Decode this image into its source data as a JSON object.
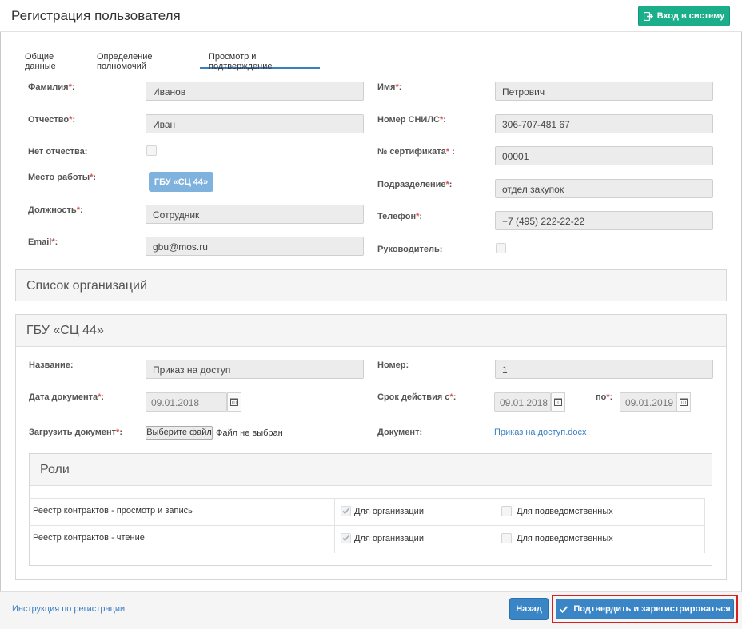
{
  "header": {
    "title": "Регистрация пользователя",
    "login_label": "Вход в систему"
  },
  "tabs": [
    {
      "label": "Общие данные"
    },
    {
      "label": "Определение полномочий"
    },
    {
      "label": "Просмотр и подтверждение",
      "active": true
    }
  ],
  "form": {
    "lastname": {
      "label": "Фамилия",
      "req": "*",
      "suffix": ":",
      "value": "Иванов"
    },
    "firstname": {
      "label": "Имя",
      "req": "*",
      "suffix": ":",
      "value": "Петрович"
    },
    "patronymic": {
      "label": "Отчество",
      "req": "*",
      "suffix": ":",
      "value": "Иван"
    },
    "snils": {
      "label": "Номер СНИЛС",
      "req": "*",
      "suffix": ":",
      "value": "306-707-481 67"
    },
    "no_patronymic": {
      "label": "Нет отчества:"
    },
    "certificate": {
      "label": "№ сертификата",
      "req": "*",
      "suffix": " :",
      "value": "00001"
    },
    "workplace": {
      "label": "Место работы",
      "req": "*",
      "suffix": ":",
      "value": "ГБУ «СЦ 44»"
    },
    "department": {
      "label": "Подразделение",
      "req": "*",
      "suffix": ":",
      "value": "отдел закупок"
    },
    "position": {
      "label": "Должность",
      "req": "*",
      "suffix": ":",
      "value": "Сотрудник"
    },
    "phone": {
      "label": "Телефон",
      "req": "*",
      "suffix": ":",
      "value": "+7 (495) 222-22-22"
    },
    "email": {
      "label": "Email",
      "req": "*",
      "suffix": ":",
      "value": "gbu@mos.ru"
    },
    "manager": {
      "label": "Руководитель:"
    }
  },
  "org_list": {
    "title": "Список организаций"
  },
  "org": {
    "title": "ГБУ «СЦ 44»",
    "name": {
      "label": "Название:",
      "value": "Приказ на доступ"
    },
    "number": {
      "label": "Номер:",
      "value": "1"
    },
    "doc_date": {
      "label": "Дата документа",
      "req": "*",
      "suffix": ":",
      "value": "09.01.2018"
    },
    "valid_from": {
      "label": "Срок действия с",
      "req": "*",
      "suffix": ":",
      "value": "09.01.2018"
    },
    "valid_to": {
      "label": "по",
      "req": "*",
      "suffix": ":",
      "value": "09.01.2019"
    },
    "upload": {
      "label": "Загрузить документ",
      "req": "*",
      "suffix": ":",
      "button": "Выберите файл",
      "status": "Файл не выбран"
    },
    "document": {
      "label": "Документ:",
      "link": "Приказ на доступ.docx"
    }
  },
  "roles": {
    "title": "Роли",
    "rows": [
      {
        "name": "Реестр контрактов - просмотр и запись",
        "org_label": "Для организации",
        "org_checked": true,
        "sub_label": "Для подведомственных",
        "sub_checked": false
      },
      {
        "name": "Реестр контрактов - чтение",
        "org_label": "Для организации",
        "org_checked": true,
        "sub_label": "Для подведомственных",
        "sub_checked": false
      }
    ]
  },
  "footer": {
    "help_link": "Инструкция по регистрации",
    "back_label": "Назад",
    "confirm_label": "Подтвердить и зарегистрироваться"
  },
  "colors": {
    "login_button": "#1aae8a",
    "primary_button": "#3a85c6",
    "highlight_border": "#d9201f",
    "required_mark": "#d9534f"
  },
  "icons": {
    "login": "sign-in-icon",
    "calendar": "calendar-icon",
    "check": "checkmark-icon"
  }
}
